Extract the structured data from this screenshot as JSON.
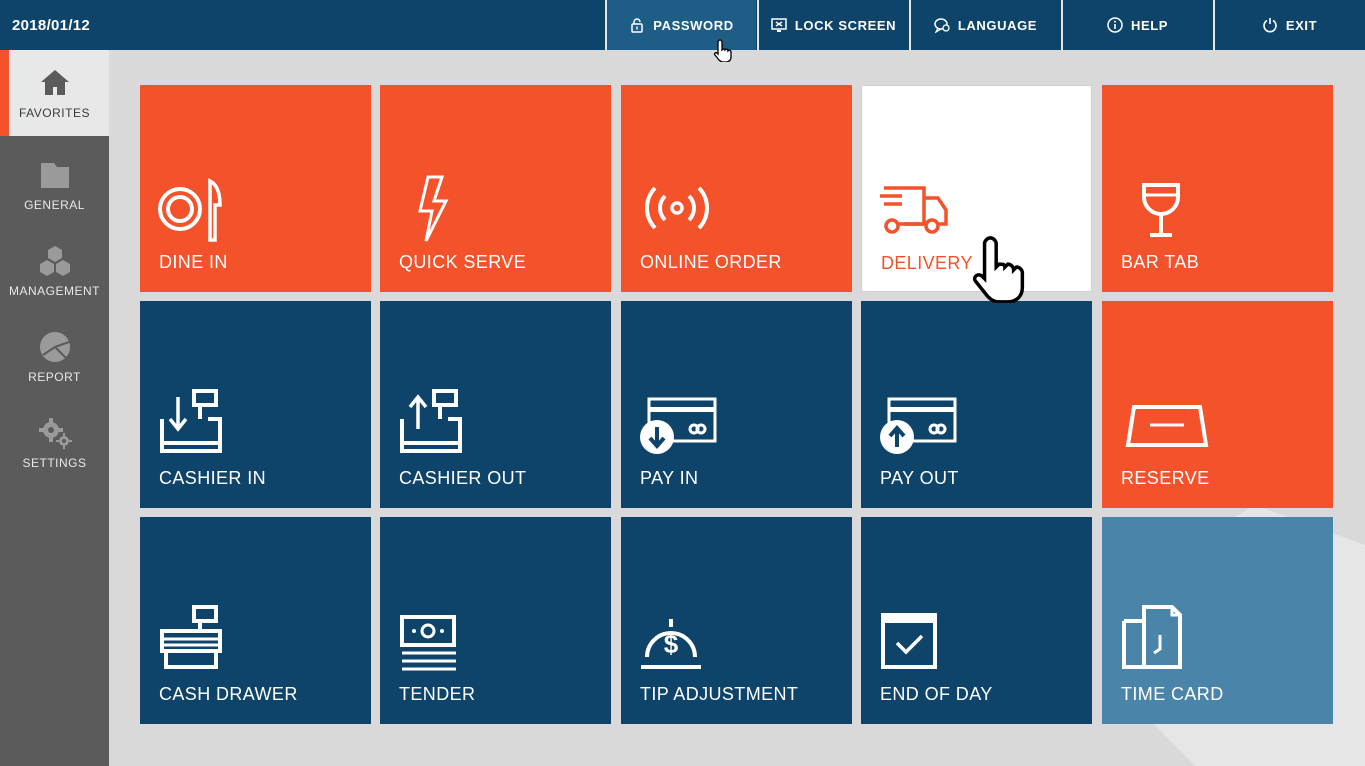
{
  "topbar": {
    "date": "2018/01/12",
    "buttons": [
      {
        "label": "PASSWORD",
        "icon": "lock-icon"
      },
      {
        "label": "LOCK SCREEN",
        "icon": "lock-screen-icon"
      },
      {
        "label": "LANGUAGE",
        "icon": "language-icon"
      },
      {
        "label": "HELP",
        "icon": "info-icon"
      },
      {
        "label": "EXIT",
        "icon": "power-icon"
      }
    ]
  },
  "sidebar": {
    "items": [
      {
        "label": "FAVORITES",
        "icon": "home-icon",
        "active": true
      },
      {
        "label": "GENERAL",
        "icon": "folder-icon"
      },
      {
        "label": "MANAGEMENT",
        "icon": "cubes-icon"
      },
      {
        "label": "REPORT",
        "icon": "pie-chart-icon"
      },
      {
        "label": "SETTINGS",
        "icon": "gears-icon"
      }
    ]
  },
  "tiles": [
    {
      "label": "DINE IN",
      "icon": "plate-knife-icon",
      "color": "#f4522b"
    },
    {
      "label": "QUICK SERVE",
      "icon": "lightning-icon",
      "color": "#f4522b"
    },
    {
      "label": "ONLINE ORDER",
      "icon": "broadcast-icon",
      "color": "#f4522b"
    },
    {
      "label": "DELIVERY",
      "icon": "truck-icon",
      "color": "#ffffff"
    },
    {
      "label": "BAR TAB",
      "icon": "wine-glass-icon",
      "color": "#f4522b"
    },
    {
      "label": "CASHIER IN",
      "icon": "register-in-icon",
      "color": "#0e4469"
    },
    {
      "label": "CASHIER OUT",
      "icon": "register-out-icon",
      "color": "#0e4469"
    },
    {
      "label": "PAY IN",
      "icon": "card-in-icon",
      "color": "#0e4469"
    },
    {
      "label": "PAY OUT",
      "icon": "card-out-icon",
      "color": "#0e4469"
    },
    {
      "label": "RESERVE",
      "icon": "reserve-sign-icon",
      "color": "#f4522b"
    },
    {
      "label": "CASH DRAWER",
      "icon": "cash-drawer-icon",
      "color": "#0e4469"
    },
    {
      "label": "TENDER",
      "icon": "banknote-icon",
      "color": "#0e4469"
    },
    {
      "label": "TIP ADJUSTMENT",
      "icon": "dollar-bell-icon",
      "color": "#0e4469"
    },
    {
      "label": "END OF DAY",
      "icon": "calendar-check-icon",
      "color": "#0e4469"
    },
    {
      "label": "TIME CARD",
      "icon": "time-card-icon",
      "color": "#4a84a8"
    }
  ],
  "colors": {
    "orange": "#f4522b",
    "navy": "#0e4469",
    "steel": "#4a84a8",
    "sidebar": "#5b5b5b"
  }
}
